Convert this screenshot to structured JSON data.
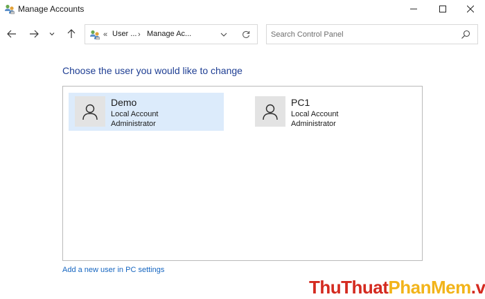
{
  "window": {
    "title": "Manage Accounts"
  },
  "navigation": {
    "breadcrumb": {
      "prefix": "«",
      "segments": [
        "User ...",
        "Manage Ac..."
      ],
      "separator": "›"
    },
    "search": {
      "placeholder": "Search Control Panel",
      "value": ""
    }
  },
  "main": {
    "heading": "Choose the user you would like to change",
    "accounts": [
      {
        "name": "Demo",
        "type": "Local Account",
        "role": "Administrator",
        "selected": true
      },
      {
        "name": "PC1",
        "type": "Local Account",
        "role": "Administrator",
        "selected": false
      }
    ],
    "add_user_link": "Add a new user in PC settings"
  },
  "watermark": {
    "part1": "ThuThuat",
    "part2": "PhanMem",
    "part3": ".vn"
  },
  "colors": {
    "heading": "#1e3e93",
    "link": "#1565c0",
    "selected_tile": "#dcebfb",
    "watermark_red": "#d42a1f",
    "watermark_yellow": "#f2b41a"
  },
  "icons": {
    "app": "users-control-panel-icon",
    "back": "arrow-left-icon",
    "forward": "arrow-right-icon",
    "recent": "chevron-down-icon",
    "up": "arrow-up-icon",
    "address_dropdown": "chevron-down-icon",
    "refresh": "refresh-icon",
    "search": "search-icon",
    "avatar": "user-silhouette-icon"
  }
}
